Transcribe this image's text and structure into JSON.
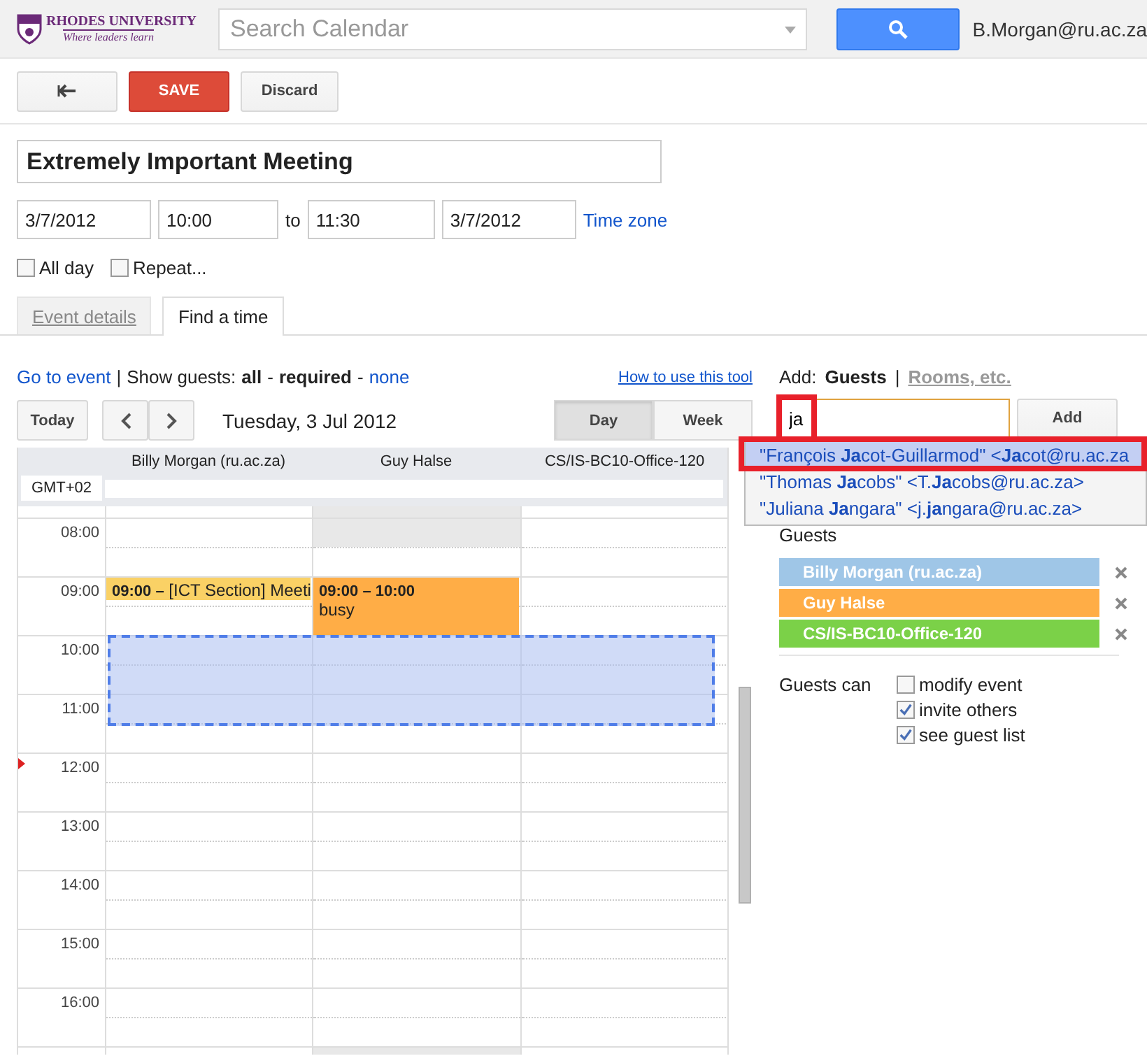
{
  "header": {
    "logo": {
      "name": "RHODES UNIVERSITY",
      "tagline": "Where leaders learn"
    },
    "search": {
      "placeholder": "Search Calendar"
    },
    "user": "B.Morgan@ru.ac.za"
  },
  "toolbar": {
    "buttons": [
      {
        "kind": "back"
      },
      {
        "kind": "primary",
        "label": "SAVE"
      },
      {
        "kind": "default",
        "label": "Discard"
      }
    ]
  },
  "event": {
    "title": "Extremely Important Meeting",
    "start_date": "3/7/2012",
    "start_time": "10:00",
    "to": "to",
    "end_time": "11:30",
    "end_date": "3/7/2012",
    "time_zone": "Time zone",
    "options": [
      {
        "label": "All day",
        "checked": false
      },
      {
        "label": "Repeat...",
        "checked": false
      }
    ]
  },
  "tabs": [
    {
      "label": "Event details",
      "selected": false
    },
    {
      "label": "Find a time",
      "selected": true
    }
  ],
  "find_time": {
    "go_to_event": "Go to event",
    "separator": "|",
    "show_guests_label": "Show guests:",
    "show_guests": [
      {
        "label": "all",
        "selected": true
      },
      {
        "label": "required",
        "selected": true,
        "separator_before": "-"
      },
      {
        "label": "none",
        "selected": false,
        "separator_before": "-"
      }
    ],
    "help_link": "How to use this tool",
    "today": "Today",
    "date": "Tuesday, 3 Jul 2012",
    "views": [
      {
        "label": "Day",
        "selected": true
      },
      {
        "label": "Week",
        "selected": false
      }
    ]
  },
  "grid": {
    "timezone": "GMT+02",
    "columns": [
      {
        "name": "Billy Morgan (ru.ac.za)",
        "outside_hours": false,
        "events": [
          {
            "time": "09:00 –",
            "title": "[ICT Section] Meeti",
            "color": "#fad165"
          }
        ]
      },
      {
        "name": "Guy Halse",
        "outside_hours": true,
        "events": [
          {
            "time": "09:00 – 10:00",
            "title": "busy",
            "color": "#ffad46"
          }
        ]
      },
      {
        "name": "CS/IS-BC10-Office-120",
        "outside_hours": false
      }
    ],
    "hours": [
      "08:00",
      "09:00",
      "10:00",
      "11:00",
      "12:00",
      "13:00",
      "14:00",
      "15:00",
      "16:00"
    ],
    "selection_visible": true
  },
  "guests_panel": {
    "add_label": "Add:",
    "separator": "|",
    "modes": [
      {
        "label": "Guests",
        "selected": true
      },
      {
        "label": "Rooms, etc.",
        "selected": false
      }
    ],
    "input": {
      "value": "ja",
      "highlighted": true
    },
    "add_button": "Add",
    "suggestions": [
      {
        "text": "\"François **Ja**cot-Guillarmod\" <**Ja**cot@ru.ac.za",
        "selected": true,
        "highlighted": true
      },
      {
        "text": "\"Thomas **Ja**cobs\" <T.**Ja**cobs@ru.ac.za>",
        "selected": false,
        "highlighted": false
      },
      {
        "text": "\"Juliana **Ja**ngara\" <j.**ja**ngara@ru.ac.za>",
        "selected": false,
        "highlighted": false
      }
    ],
    "heading": "Guests",
    "guests": [
      {
        "name": "Billy Morgan (ru.ac.za)",
        "color": "#9fc6e7"
      },
      {
        "name": "Guy Halse",
        "color": "#ffad46"
      },
      {
        "name": "CS/IS-BC10-Office-120",
        "color": "#7bd148"
      }
    ],
    "permissions_label": "Guests can",
    "permissions": [
      {
        "label": "modify event",
        "checked": false
      },
      {
        "label": "invite others",
        "checked": true
      },
      {
        "label": "see guest list",
        "checked": true
      }
    ]
  }
}
